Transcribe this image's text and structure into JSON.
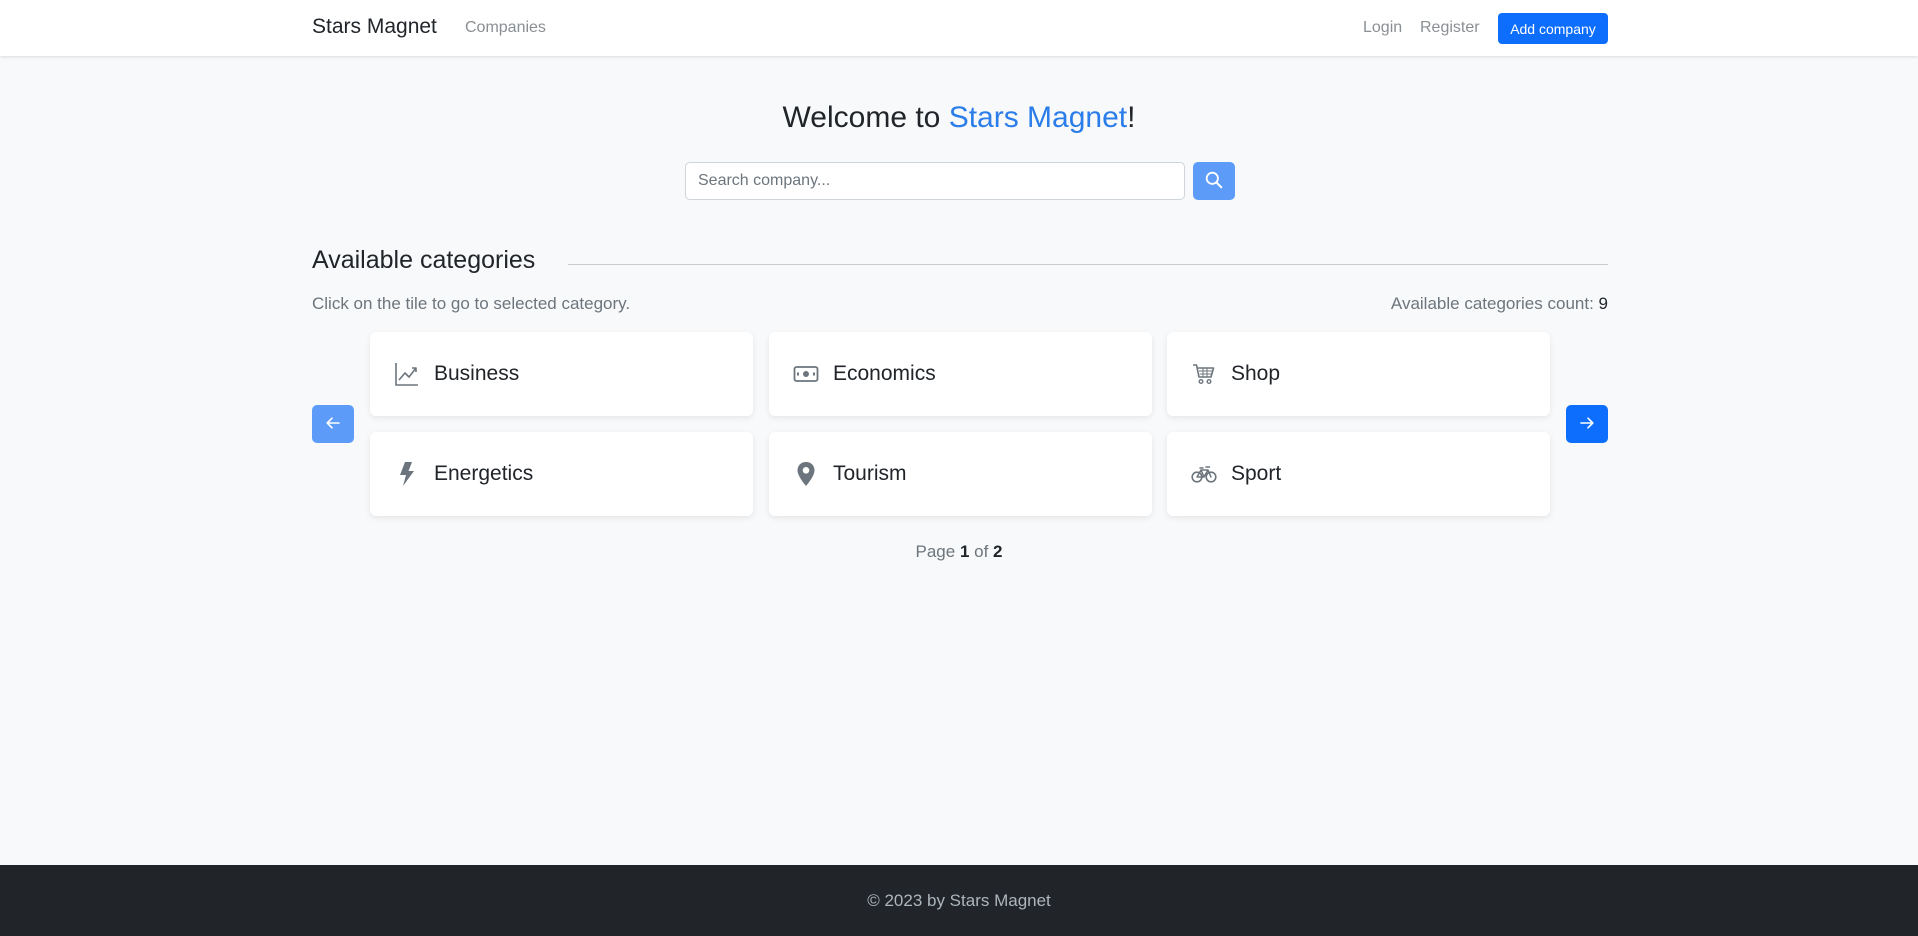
{
  "navbar": {
    "brand": "Stars Magnet",
    "links": {
      "companies": "Companies",
      "login": "Login",
      "register": "Register"
    },
    "add_company_label": "Add company"
  },
  "hero": {
    "welcome_prefix": "Welcome to ",
    "welcome_brand": "Stars Magnet",
    "welcome_suffix": "!",
    "search": {
      "placeholder": "Search company...",
      "value": ""
    }
  },
  "categories": {
    "title": "Available categories",
    "hint": "Click on the tile to go to selected category.",
    "count_label": "Available categories count: ",
    "count": "9",
    "items": [
      {
        "label": "Business",
        "icon": "chart-line-icon"
      },
      {
        "label": "Economics",
        "icon": "cash-icon"
      },
      {
        "label": "Shop",
        "icon": "cart-icon"
      },
      {
        "label": "Energetics",
        "icon": "lightning-icon"
      },
      {
        "label": "Tourism",
        "icon": "map-pin-icon"
      },
      {
        "label": "Sport",
        "icon": "bicycle-icon"
      }
    ],
    "pager": {
      "prefix": "Page ",
      "current": "1",
      "middle": " of ",
      "total": "2"
    }
  },
  "footer": {
    "text": "© 2023 by Stars Magnet"
  },
  "colors": {
    "primary": "#0d6efd",
    "primary_light": "#5c9cf8",
    "accent_text": "#2b7de9",
    "footer_bg": "#212529"
  }
}
